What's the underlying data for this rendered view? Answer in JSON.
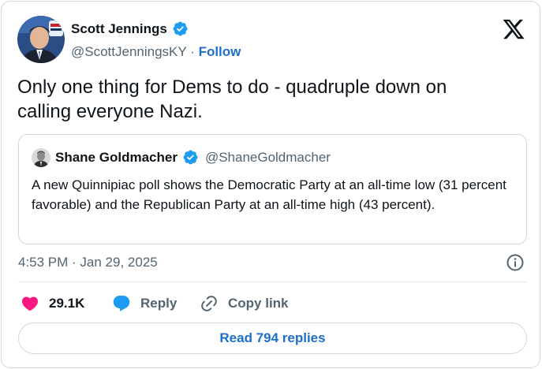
{
  "author": {
    "name": "Scott Jennings",
    "handle": "@ScottJenningsKY",
    "separator": "·",
    "follow_label": "Follow"
  },
  "tweet": {
    "text": "Only one thing for Dems to do - quadruple down on\ncalling everyone Nazi."
  },
  "quote": {
    "name": "Shane Goldmacher",
    "handle": "@ShaneGoldmacher",
    "text": "A new Quinnipiac poll shows the Democratic Party at an all-time low (31 percent favorable) and the Republican Party at an all-time high (43 percent)."
  },
  "meta": {
    "timestamp": "4:53 PM · Jan 29, 2025"
  },
  "actions": {
    "like_count": "29.1K",
    "reply_label": "Reply",
    "copy_link_label": "Copy link"
  },
  "footer": {
    "read_replies_label": "Read 794 replies"
  },
  "colors": {
    "accent": "#1d9bf0",
    "like": "#f91880",
    "link": "#1d6fc9",
    "muted": "#536471"
  }
}
